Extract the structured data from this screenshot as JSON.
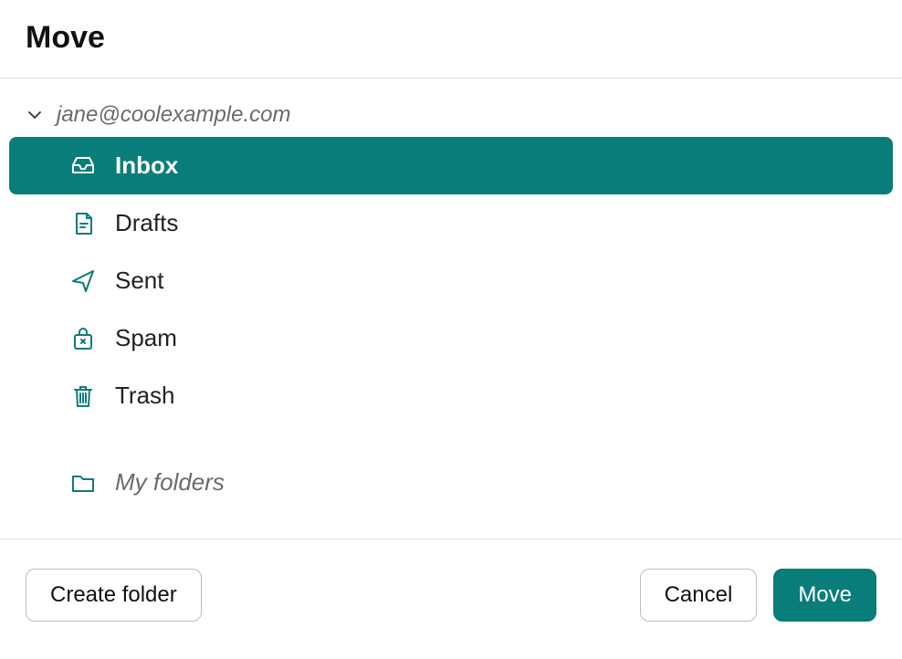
{
  "dialog": {
    "title": "Move",
    "account": "jane@coolexample.com",
    "folders": [
      {
        "id": "inbox",
        "label": "Inbox",
        "icon": "inbox-icon",
        "selected": true
      },
      {
        "id": "drafts",
        "label": "Drafts",
        "icon": "drafts-icon",
        "selected": false
      },
      {
        "id": "sent",
        "label": "Sent",
        "icon": "sent-icon",
        "selected": false
      },
      {
        "id": "spam",
        "label": "Spam",
        "icon": "spam-icon",
        "selected": false
      },
      {
        "id": "trash",
        "label": "Trash",
        "icon": "trash-icon",
        "selected": false
      }
    ],
    "my_folders_label": "My folders",
    "buttons": {
      "create_folder": "Create folder",
      "cancel": "Cancel",
      "move": "Move"
    },
    "colors": {
      "accent": "#097d7a"
    }
  }
}
